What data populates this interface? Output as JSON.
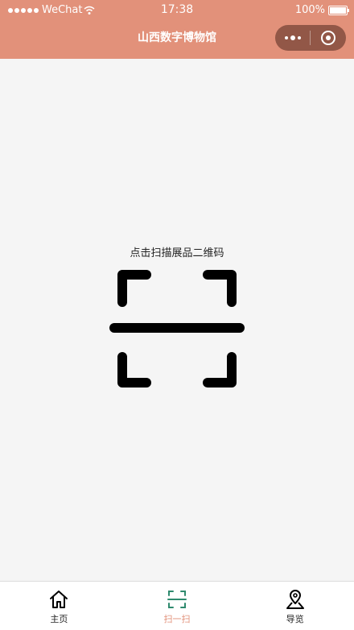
{
  "status_bar": {
    "carrier": "WeChat",
    "time": "17:38",
    "battery": "100%"
  },
  "nav": {
    "title": "山西数字博物馆"
  },
  "scan": {
    "prompt": "点击扫描展品二维码",
    "icon": "scan-icon"
  },
  "tabs": [
    {
      "label": "主页",
      "icon": "home-icon",
      "active": false
    },
    {
      "label": "扫一扫",
      "icon": "scan-icon",
      "active": true
    },
    {
      "label": "导览",
      "icon": "map-pin-icon",
      "active": false
    }
  ],
  "colors": {
    "header": "#e2917a",
    "background": "#f5f5f5",
    "active_tab": "#e2917a",
    "scan_tab_icon": "#2f8a6e"
  }
}
